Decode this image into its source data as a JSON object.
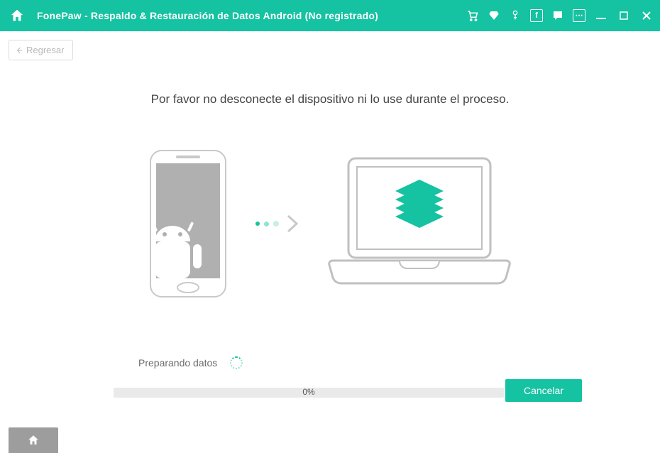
{
  "titlebar": {
    "app_name": "FonePaw",
    "subtitle": "Respaldo & Restauración de Datos Android (No registrado)",
    "full_title": "FonePaw -  Respaldo & Restauración de Datos Android (No registrado)"
  },
  "back_button": {
    "label": "Regresar"
  },
  "main": {
    "instruction": "Por favor no desconecte el dispositivo ni lo use durante el proceso."
  },
  "status": {
    "label": "Preparando datos"
  },
  "progress": {
    "percent_label": "0%"
  },
  "cancel": {
    "label": "Cancelar"
  },
  "colors": {
    "accent": "#15c2a1"
  }
}
